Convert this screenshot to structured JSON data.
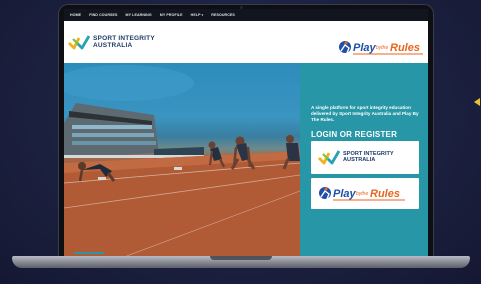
{
  "nav": {
    "items": [
      "HOME",
      "FIND COURSES",
      "MY LEARNING",
      "MY PROFILE",
      "HELP",
      "RESOURCES"
    ]
  },
  "header": {
    "org_name_line1": "SPORT INTEGRITY",
    "org_name_line2": "AUSTRALIA",
    "partner_logo_text": "PlaybytheRules"
  },
  "panel": {
    "intro": "A single platform for sport integrity education delivered by Sport Integrity Australia and Play By The Rules.",
    "login_heading": "LOGIN OR REGISTER",
    "sia_card_line1": "SPORT INTEGRITY",
    "sia_card_line2": "AUSTRALIA",
    "pbr_card_text": "PlaybytheRules"
  },
  "colors": {
    "panel_teal": "#2796a6",
    "nav_dark": "#11151d",
    "sia_navy": "#1e3a6b",
    "pbr_orange": "#e8661f",
    "pbr_blue": "#1f4fa8",
    "background": "#1c2140"
  },
  "icons": {
    "sia_mark": "chevron-check-mark",
    "pbr_mark": "runner-figure"
  }
}
